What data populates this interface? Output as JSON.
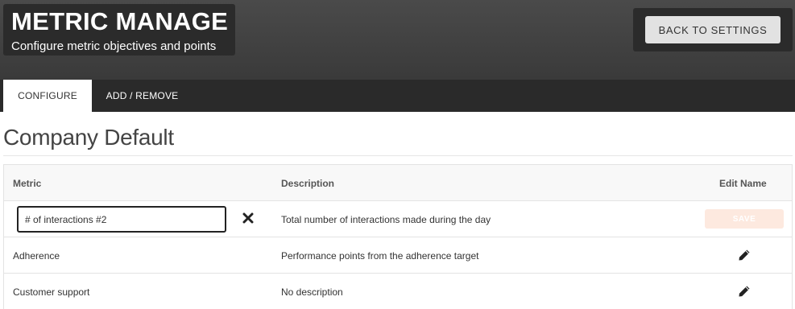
{
  "header": {
    "title": "METRIC MANAGE",
    "subtitle": "Configure metric objectives and points",
    "back_button": "BACK TO SETTINGS"
  },
  "tabs": [
    {
      "label": "CONFIGURE",
      "active": true
    },
    {
      "label": "ADD / REMOVE",
      "active": false
    }
  ],
  "section": {
    "title": "Company Default"
  },
  "table": {
    "columns": {
      "metric": "Metric",
      "description": "Description",
      "edit_name": "Edit Name"
    },
    "rows": [
      {
        "metric": "# of interactions #2",
        "description": "Total number of interactions made during the day",
        "editing": true,
        "save_label": "SAVE",
        "clear_icon": "x-icon"
      },
      {
        "metric": "Adherence",
        "description": "Performance points from the adherence target",
        "editing": false,
        "edit_icon": "pencil-icon"
      },
      {
        "metric": "Customer support",
        "description": "No description",
        "editing": false,
        "edit_icon": "pencil-icon"
      }
    ]
  },
  "colors": {
    "header_bg": "#404040",
    "title_box_bg": "#2b2b2b",
    "tabbar_bg": "#2a2a2a",
    "save_disabled_bg": "#fde9df"
  }
}
